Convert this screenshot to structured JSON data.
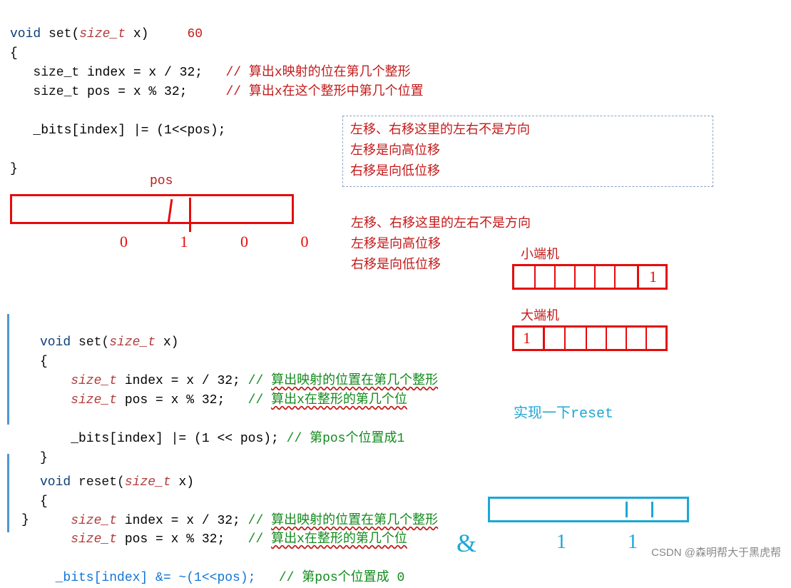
{
  "code1": {
    "l1_a": "void",
    "l1_b": "set",
    "l1_c": "size_t",
    "l1_d": " x)     ",
    "l1_num": "60",
    "l2": "{",
    "l3_a": "   size_t",
    "l3_b": " index = x / 32;   ",
    "l3_c": "// 算出x映射的位在第几个整形",
    "l4_a": "   size_t",
    "l4_b": " pos = x % 32;     ",
    "l4_c": "// 算出x在这个整形中第几个位置",
    "l5": "   _bits[index] |= (1<<pos);",
    "l6": "}"
  },
  "note1": {
    "a": "左移、右移这里的左右不是方向",
    "b": "左移是向高位移",
    "c": "右移是向低位移"
  },
  "note2": {
    "a": "左移、右移这里的左右不是方向",
    "b": "左移是向高位移",
    "c": "右移是向低位移"
  },
  "pos_label": "pos",
  "digits": "0 1 0 0",
  "small_label1": "小端机",
  "small_label2": "大端机",
  "blue_note": "实现一下reset",
  "code2": {
    "l1_a": "void",
    "l1_b": " set(",
    "l1_c": "size_t",
    "l1_d": " x)",
    "l2": "{",
    "l3_a": "    size_t",
    "l3_b": " index = x / 32;",
    "l3_c": " // ",
    "l3_d": "算出映射的位置在第几个整形",
    "l4_a": "    size_t",
    "l4_b": " pos = x % 32;  ",
    "l4_c": " // ",
    "l4_d": "算出x在整形的第几个位",
    "l5_a": "    _bits[index] |= (1 << pos);",
    "l5_b": " // 第pos个位置成1",
    "l6": "}"
  },
  "code3": {
    "l1_a": "void",
    "l1_b": " reset(",
    "l1_c": "size_t",
    "l1_d": " x)",
    "l2": "{",
    "l3_a": "    size_t",
    "l3_b": " index = x / 32;",
    "l3_c": " // ",
    "l3_d": "算出映射的位置在第几个整形",
    "brace_close": "}",
    "l4_a": "    size_t",
    "l4_b": " pos = x % 32;  ",
    "l4_c": " // ",
    "l4_d": "算出x在整形的第几个位",
    "l5_a": "  _bits[index] &= ~(1<<pos);   ",
    "l5_b": "// 第pos个位置成 0"
  },
  "watermark": "CSDN @森明帮大于黑虎帮"
}
